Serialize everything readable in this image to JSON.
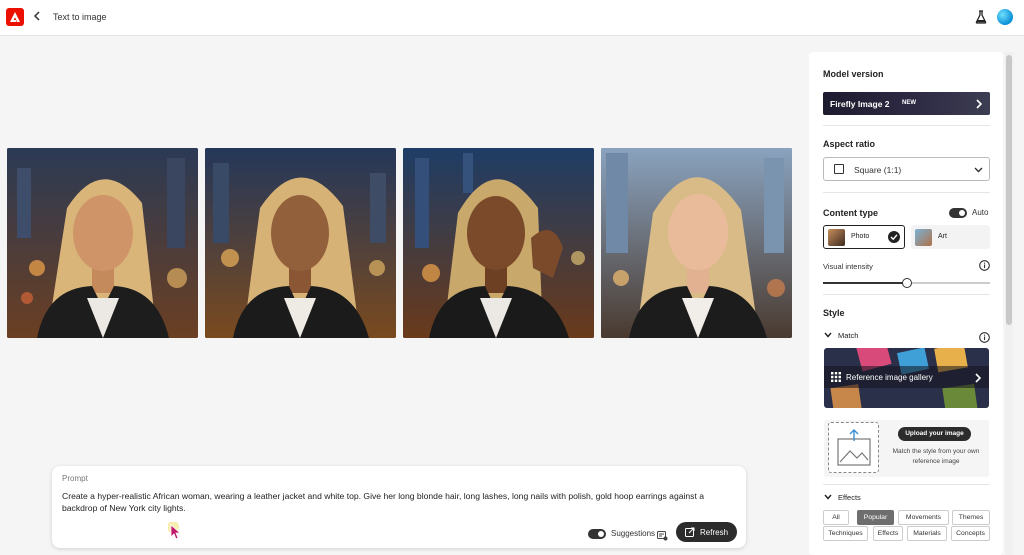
{
  "header": {
    "title": "Text to image"
  },
  "gallery": {
    "images": [
      {
        "alt": "Generated portrait 1"
      },
      {
        "alt": "Generated portrait 2"
      },
      {
        "alt": "Generated portrait 3"
      },
      {
        "alt": "Generated portrait 4"
      }
    ]
  },
  "prompt": {
    "label": "Prompt",
    "text": "Create a hyper-realistic African woman, wearing a leather jacket and white top. Give her long blonde hair, long lashes, long nails with polish, gold hoop earrings against a backdrop of New York city lights.",
    "suggestions_label": "Suggestions",
    "suggestions_on": true,
    "refresh_label": "Refresh"
  },
  "panel": {
    "model_version": {
      "heading": "Model version",
      "value": "Firefly Image 2",
      "badge": "NEW"
    },
    "aspect_ratio": {
      "heading": "Aspect ratio",
      "value": "Square (1:1)"
    },
    "content_type": {
      "heading": "Content type",
      "auto_label": "Auto",
      "auto_on": true,
      "options": [
        {
          "label": "Photo",
          "selected": true
        },
        {
          "label": "Art",
          "selected": false
        }
      ]
    },
    "visual_intensity": {
      "label": "Visual intensity",
      "level": 0.5
    },
    "style": {
      "heading": "Style",
      "match": {
        "label": "Match",
        "gallery_label": "Reference image gallery",
        "upload_button": "Upload your image",
        "upload_description": "Match the style from your own reference image"
      },
      "effects": {
        "label": "Effects",
        "chips": [
          {
            "label": "All",
            "active": false
          },
          {
            "label": "Popular",
            "active": true
          },
          {
            "label": "Movements",
            "active": false
          },
          {
            "label": "Themes",
            "active": false
          },
          {
            "label": "Techniques",
            "active": false
          },
          {
            "label": "Effects",
            "active": false
          },
          {
            "label": "Materials",
            "active": false
          },
          {
            "label": "Concepts",
            "active": false
          }
        ]
      }
    }
  },
  "colors": {
    "brand": "#eb1000",
    "accent_dark": "#2c2c2c",
    "background": "#f5f5f5"
  },
  "icons": [
    "adobe-logo-icon",
    "chevron-left-icon",
    "flask-icon",
    "info-icon",
    "chevron-right-icon",
    "chevron-down-icon",
    "grid-icon",
    "upload-icon",
    "refresh-icon",
    "checkmark-icon"
  ]
}
